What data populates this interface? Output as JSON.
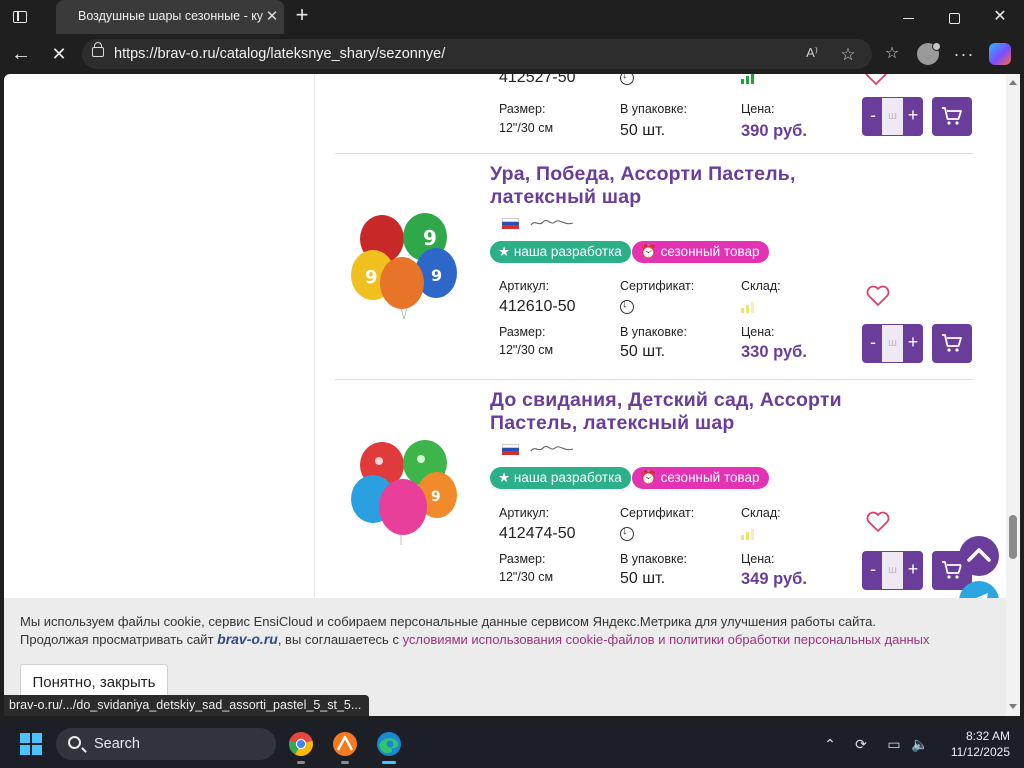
{
  "browser": {
    "tab_title": "Воздушные шары сезонные - ку",
    "tab_close": "✕",
    "new_tab": "+",
    "url": "https://brav-o.ru/catalog/lateksnye_shary/sezonnye/",
    "reader_icon": "A⁾",
    "status_url": "brav-o.ru/.../do_svidaniya_detskiy_sad_assorti_pastel_5_st_5..."
  },
  "labels": {
    "article": "Артикул:",
    "certificate": "Сертификат:",
    "stock": "Склад:",
    "size": "Размер:",
    "pack": "В упаковке:",
    "price": "Цена:",
    "tag_dev": "★ наша разработка",
    "tag_season": "сезонный товар",
    "qty_minus": "-",
    "qty_plus": "+",
    "qty_placeholder": "ш"
  },
  "products": [
    {
      "name": "",
      "article": "412527-50",
      "size": "12\"/30 см",
      "pack": "50 шт.",
      "price": "390 руб.",
      "stock_level": "high"
    },
    {
      "name": "Ура, Победа, Ассорти Пастель, латексный шар",
      "article": "412610-50",
      "size": "12\"/30 см",
      "pack": "50 шт.",
      "price": "330 руб.",
      "stock_level": "low"
    },
    {
      "name": "До свидания, Детский сад, Ассорти Пастель, латексный шар",
      "article": "412474-50",
      "size": "12\"/30 см",
      "pack": "50 шт.",
      "price": "349 руб.",
      "stock_level": "low"
    }
  ],
  "cookie": {
    "line1": "Мы используем файлы cookie, сервис EnsiCloud и собираем персональные данные сервисом Яндекс.Метрика для улучшения работы сайта.",
    "line2_start": "Продолжая просматривать сайт ",
    "brand": "brav-o.ru",
    "line2_mid": ", вы соглашаетесь с ",
    "link": "условиями использования cookie-файлов и политики обработки персональных данных",
    "button": "Понятно, закрыть"
  },
  "taskbar": {
    "search_label": "Search",
    "time": "8:32 AM",
    "date": "11/12/2025"
  },
  "colors": {
    "brand_purple": "#6a3d9a",
    "tag_green": "#2bb08a",
    "tag_pink": "#e432b5",
    "heart": "#e0416a",
    "stock_high": "#22a33a",
    "stock_low": "#efe36a"
  }
}
